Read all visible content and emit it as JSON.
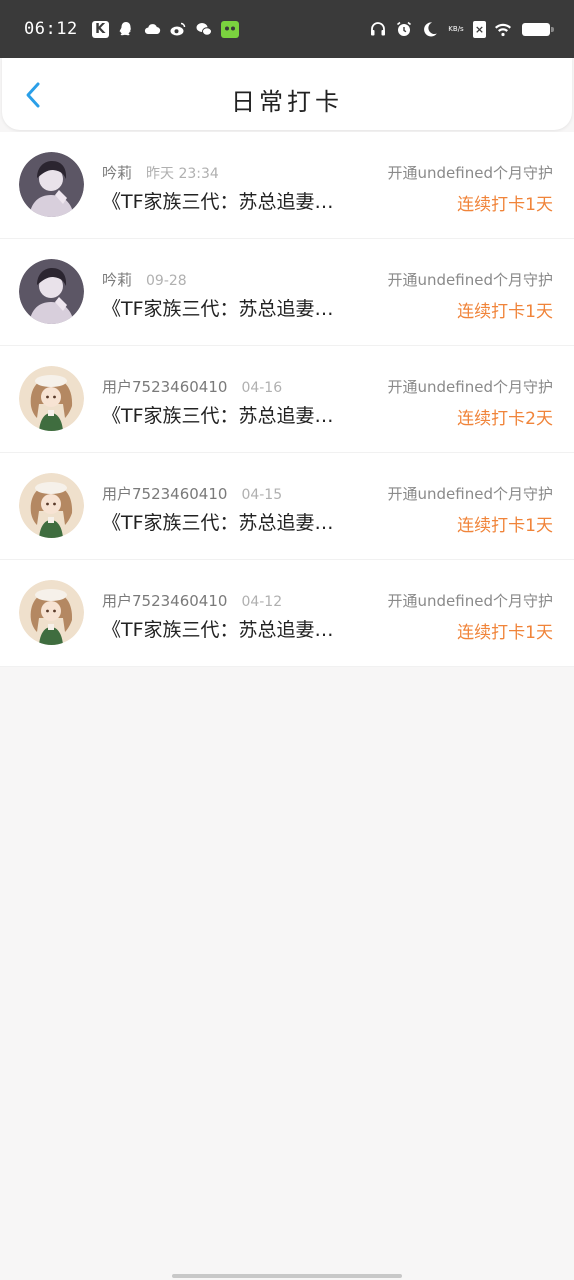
{
  "status_bar": {
    "time": "06:12",
    "k_icon_label": "K",
    "speed_label": "KB/s",
    "x_icon_label": "×"
  },
  "header": {
    "title": "日常打卡",
    "back_icon": "chevron-left-icon",
    "accent_color": "#2a9fe8"
  },
  "records": [
    {
      "user": "吟莉",
      "time": "昨天 23:34",
      "title": "《TF家族三代：苏总追妻…",
      "guard": "开通undefined个月守护",
      "streak": "连续打卡1天",
      "avatar": "dark-haired-avatar"
    },
    {
      "user": "吟莉",
      "time": "09-28",
      "title": "《TF家族三代：苏总追妻…",
      "guard": "开通undefined个月守护",
      "streak": "连续打卡1天",
      "avatar": "dark-haired-avatar"
    },
    {
      "user": "用户7523460410",
      "time": "04-16",
      "title": "《TF家族三代：苏总追妻…",
      "guard": "开通undefined个月守护",
      "streak": "连续打卡2天",
      "avatar": "girl-avatar"
    },
    {
      "user": "用户7523460410",
      "time": "04-15",
      "title": "《TF家族三代：苏总追妻…",
      "guard": "开通undefined个月守护",
      "streak": "连续打卡1天",
      "avatar": "girl-avatar"
    },
    {
      "user": "用户7523460410",
      "time": "04-12",
      "title": "《TF家族三代：苏总追妻…",
      "guard": "开通undefined个月守护",
      "streak": "连续打卡1天",
      "avatar": "girl-avatar"
    }
  ],
  "colors": {
    "streak": "#f0843a",
    "status_bar_bg": "#3a3a3a",
    "page_bg": "#f7f6f6"
  }
}
